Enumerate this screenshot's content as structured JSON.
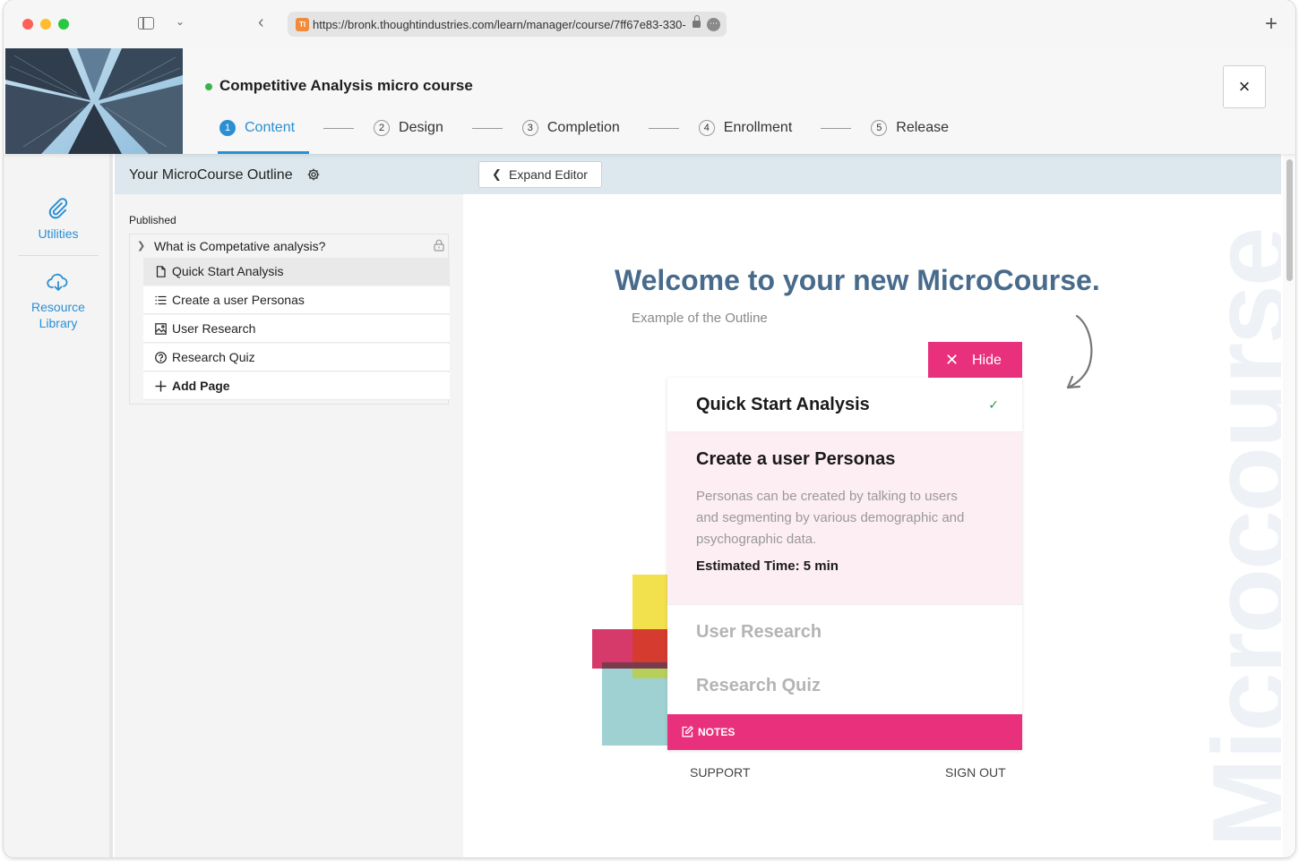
{
  "browser": {
    "url": "https://bronk.thoughtindustries.com/learn/manager/course/7ff67e83-330-",
    "favicon_label": "TI"
  },
  "course": {
    "title": "Competitive Analysis micro course",
    "status_color": "#3bb34a",
    "steps": [
      {
        "num": "1",
        "label": "Content"
      },
      {
        "num": "2",
        "label": "Design"
      },
      {
        "num": "3",
        "label": "Completion"
      },
      {
        "num": "4",
        "label": "Enrollment"
      },
      {
        "num": "5",
        "label": "Release"
      }
    ],
    "close_icon": "×"
  },
  "rail": {
    "utilities": "Utilities",
    "resource_library": "Resource Library"
  },
  "outline": {
    "title": "Your MicroCourse Outline",
    "expand_editor": "Expand Editor",
    "published_label": "Published",
    "section": "What is Competative analysis?",
    "pages": [
      {
        "label": "Quick Start Analysis",
        "icon": "page-icon"
      },
      {
        "label": "Create a user Personas",
        "icon": "list-icon"
      },
      {
        "label": "User Research",
        "icon": "image-icon"
      },
      {
        "label": "Research Quiz",
        "icon": "quiz-icon"
      }
    ],
    "add_page": "Add Page"
  },
  "preview": {
    "welcome": "Welcome to your new MicroCourse.",
    "example": "Example of the Outline",
    "watermark": "Microcourse",
    "hide": "Hide",
    "items": [
      {
        "title": "Quick Start Analysis"
      },
      {
        "title": "Create a user Personas",
        "description": "Personas can be created by talking to users and segmenting by various demographic and psychographic data.",
        "time": "Estimated Time: 5 min"
      },
      {
        "title": "User Research"
      },
      {
        "title": "Research Quiz"
      }
    ],
    "notes": "NOTES",
    "support": "SUPPORT",
    "sign_out": "SIGN OUT",
    "accent_color": "#e9307c",
    "heading_color": "#486b8c"
  }
}
